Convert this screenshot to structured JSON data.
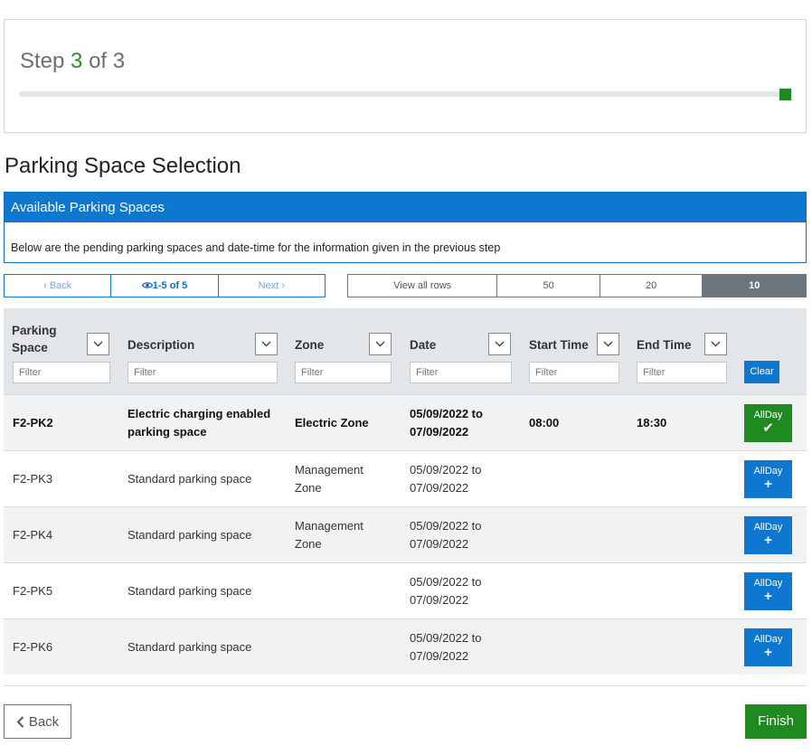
{
  "step": {
    "label": "Step",
    "current": "3",
    "of_label": "of",
    "total": "3",
    "progress": 1.0
  },
  "page_title": "Parking Space Selection",
  "available_panel": {
    "title": "Available Parking Spaces",
    "description": "Below are the pending parking spaces and date-time for the information given in the previous step"
  },
  "pager": {
    "back": "Back",
    "range": "1-5 of 5",
    "next": "Next"
  },
  "rows_per_page": {
    "options": [
      "View all rows",
      "50",
      "20",
      "10"
    ],
    "selected": "10"
  },
  "table": {
    "columns": [
      {
        "label": "Parking Space",
        "filter_placeholder": "Filter"
      },
      {
        "label": "Description",
        "filter_placeholder": "Filter"
      },
      {
        "label": "Zone",
        "filter_placeholder": "Filter"
      },
      {
        "label": "Date",
        "filter_placeholder": "Filter"
      },
      {
        "label": "Start Time",
        "filter_placeholder": "Filter"
      },
      {
        "label": "End Time",
        "filter_placeholder": "Filter"
      }
    ],
    "clear_label": "Clear",
    "rows": [
      {
        "space": "F2-PK2",
        "description": "Electric charging enabled parking space",
        "zone": "Electric Zone",
        "date": "05/09/2022 to 07/09/2022",
        "start": "08:00",
        "end": "18:30",
        "action": "AllDay",
        "selected": true
      },
      {
        "space": "F2-PK3",
        "description": "Standard parking space",
        "zone": "Management Zone",
        "date": "05/09/2022 to 07/09/2022",
        "start": "",
        "end": "",
        "action": "AllDay",
        "selected": false
      },
      {
        "space": "F2-PK4",
        "description": "Standard parking space",
        "zone": "Management Zone",
        "date": "05/09/2022 to 07/09/2022",
        "start": "",
        "end": "",
        "action": "AllDay",
        "selected": false
      },
      {
        "space": "F2-PK5",
        "description": "Standard parking space",
        "zone": "",
        "date": "05/09/2022 to 07/09/2022",
        "start": "",
        "end": "",
        "action": "AllDay",
        "selected": false
      },
      {
        "space": "F2-PK6",
        "description": "Standard parking space",
        "zone": "",
        "date": "05/09/2022 to 07/09/2022",
        "start": "",
        "end": "",
        "action": "AllDay",
        "selected": false
      }
    ]
  },
  "footer": {
    "back": "Back",
    "finish": "Finish"
  },
  "colors": {
    "primary": "#0e78d0",
    "success": "#1f8a1f",
    "muted": "#6c757d"
  },
  "icons": {
    "selected": "check-icon",
    "add": "plus-icon",
    "view": "eye-icon"
  }
}
